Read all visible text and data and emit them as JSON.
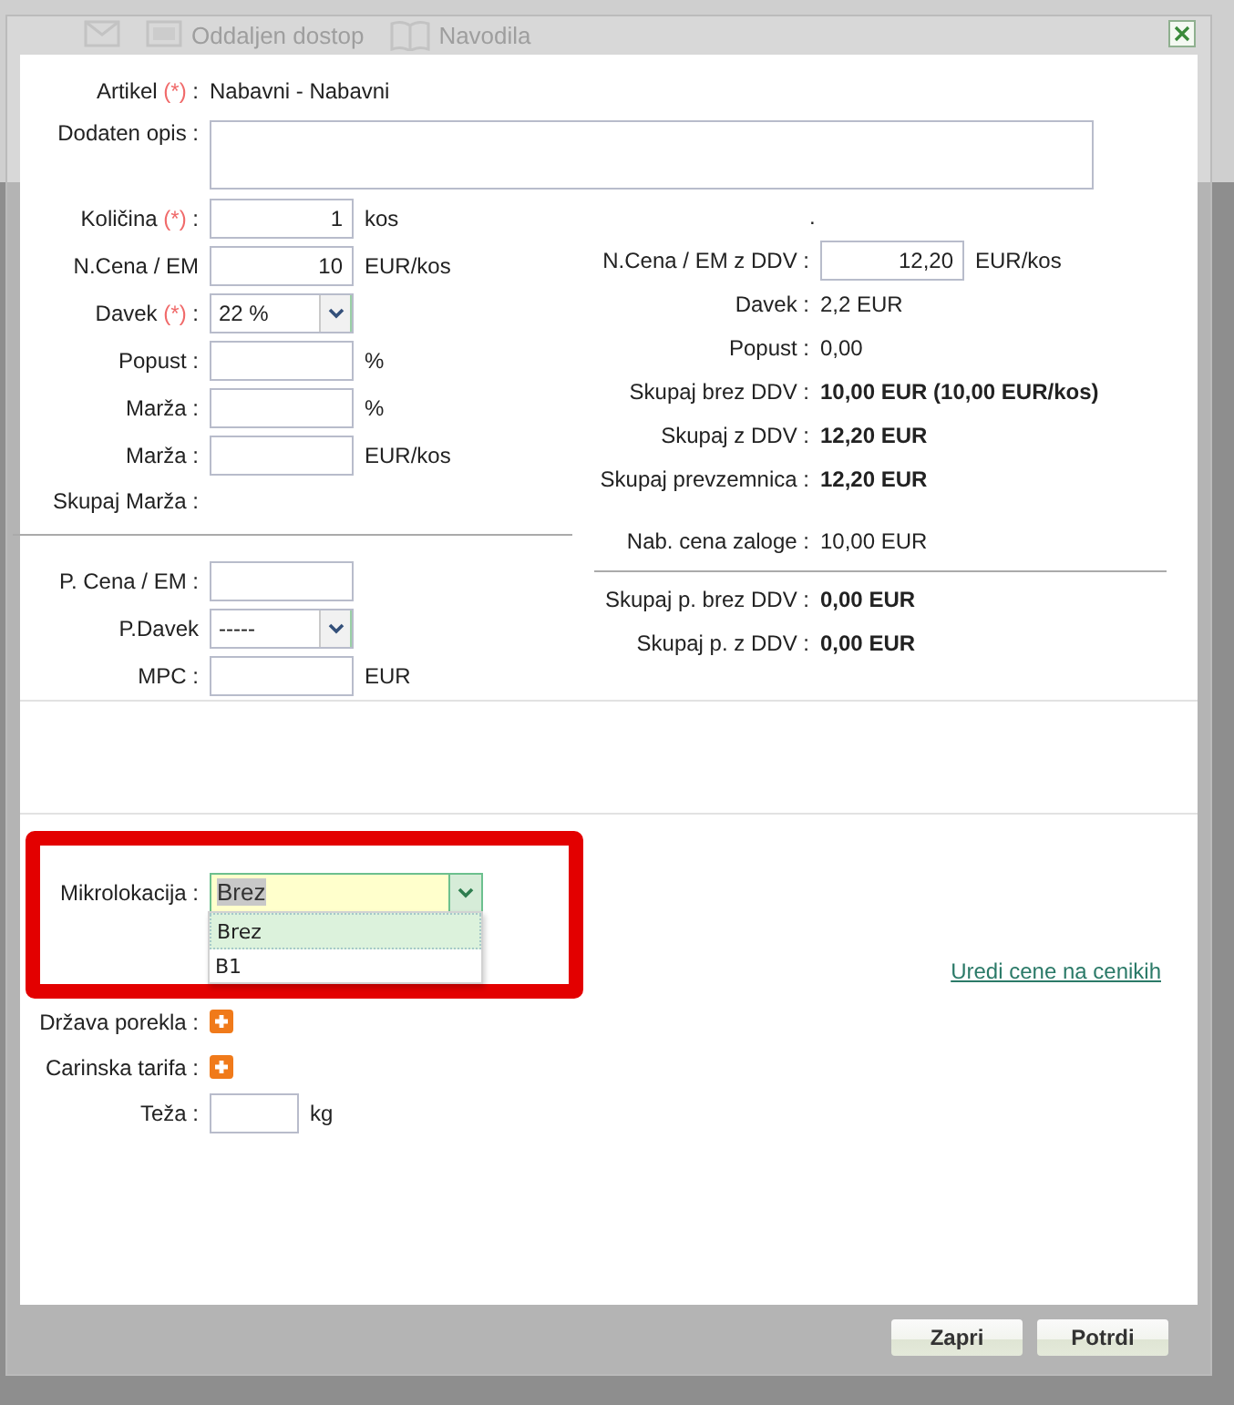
{
  "background": {
    "toolbar_labels": [
      "Oddaljen dostop",
      "Navodila"
    ]
  },
  "dialog": {
    "article": {
      "label": "Artikel",
      "required_mark": "(*)",
      "colon": ":",
      "value": "Nabavni - Nabavni"
    },
    "description": {
      "label": "Dodaten opis :"
    },
    "left_rows": [
      {
        "kind": "input",
        "label": "Količina",
        "required_mark": "(*)",
        "colon": ":",
        "value": "1",
        "unit": "kos"
      },
      {
        "kind": "input",
        "label": "N.Cena / EM",
        "value": "10",
        "unit": "EUR/kos"
      },
      {
        "kind": "select",
        "label": "Davek",
        "required_mark": "(*)",
        "colon": ":",
        "value": "22 %"
      },
      {
        "kind": "input",
        "label": "Popust :",
        "unit": "%"
      },
      {
        "kind": "input",
        "label": "Marža :",
        "unit": "%"
      },
      {
        "kind": "input",
        "label": "Marža :",
        "unit": "EUR/kos"
      },
      {
        "kind": "text",
        "label": "Skupaj Marža :"
      },
      {
        "kind": "separator"
      },
      {
        "kind": "input",
        "label": "P. Cena / EM :"
      },
      {
        "kind": "select",
        "label": "P.Davek",
        "value": "-----"
      },
      {
        "kind": "input",
        "label": "MPC :",
        "unit": "EUR"
      }
    ],
    "right_rows": [
      {
        "kind": "note",
        "text": "."
      },
      {
        "kind": "input",
        "label": "N.Cena / EM z DDV :",
        "value": "12,20",
        "unit": "EUR/kos"
      },
      {
        "kind": "text",
        "label": "Davek :",
        "value": "2,2 EUR"
      },
      {
        "kind": "text",
        "label": "Popust :",
        "value": "0,00"
      },
      {
        "kind": "total",
        "label": "Skupaj brez DDV :",
        "value": "10,00 EUR (10,00 EUR/kos)"
      },
      {
        "kind": "total",
        "label": "Skupaj z DDV :",
        "value": "12,20 EUR"
      },
      {
        "kind": "total",
        "label": "Skupaj prevzemnica :",
        "value": "12,20 EUR"
      },
      {
        "kind": "text",
        "label": "Nab. cena zaloge :",
        "value": "10,00 EUR"
      },
      {
        "kind": "separator"
      },
      {
        "kind": "total",
        "label": "Skupaj p. brez DDV :",
        "value": "0,00 EUR"
      },
      {
        "kind": "total",
        "label": "Skupaj p. z DDV :",
        "value": "0,00 EUR"
      }
    ],
    "microlocation": {
      "label": "Mikrolokacija :",
      "value": "Brez",
      "expanded": true,
      "options": [
        {
          "label": "Brez",
          "selected": true
        },
        {
          "label": "B1",
          "selected": false
        }
      ]
    },
    "price_link": "Uredi cene na cenikih",
    "extra_rows": [
      {
        "kind": "add",
        "label": "Država porekla :"
      },
      {
        "kind": "add",
        "label": "Carinska tarifa :"
      },
      {
        "kind": "input",
        "label": "Teža :",
        "unit": "kg"
      }
    ],
    "buttons": [
      "Zapri",
      "Potrdi"
    ]
  }
}
